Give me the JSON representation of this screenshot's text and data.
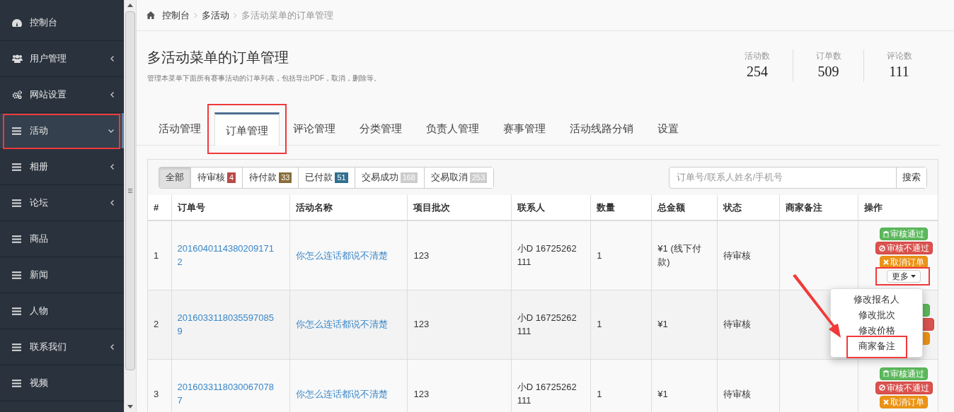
{
  "sidebar": {
    "items": [
      {
        "label": "控制台",
        "kind": "gauge",
        "expandable": false,
        "expanded": false,
        "selected": false,
        "highlighted": false
      },
      {
        "label": "用户管理",
        "kind": "users",
        "expandable": true,
        "expanded": false,
        "selected": false,
        "highlighted": false
      },
      {
        "label": "网站设置",
        "kind": "cogs",
        "expandable": true,
        "expanded": false,
        "selected": false,
        "highlighted": false
      },
      {
        "label": "活动",
        "kind": "bars",
        "expandable": true,
        "expanded": true,
        "selected": true,
        "highlighted": true
      },
      {
        "label": "相册",
        "kind": "bars",
        "expandable": true,
        "expanded": false,
        "selected": false,
        "highlighted": false
      },
      {
        "label": "论坛",
        "kind": "bars",
        "expandable": true,
        "expanded": false,
        "selected": false,
        "highlighted": false
      },
      {
        "label": "商品",
        "kind": "bars",
        "expandable": false,
        "expanded": false,
        "selected": false,
        "highlighted": false
      },
      {
        "label": "新闻",
        "kind": "bars",
        "expandable": false,
        "expanded": false,
        "selected": false,
        "highlighted": false
      },
      {
        "label": "人物",
        "kind": "bars",
        "expandable": false,
        "expanded": false,
        "selected": false,
        "highlighted": false
      },
      {
        "label": "联系我们",
        "kind": "bars",
        "expandable": true,
        "expanded": false,
        "selected": false,
        "highlighted": false
      },
      {
        "label": "视频",
        "kind": "bars",
        "expandable": false,
        "expanded": false,
        "selected": false,
        "highlighted": false
      }
    ]
  },
  "breadcrumb": [
    "控制台",
    "多活动",
    "多活动菜单的订单管理"
  ],
  "header": {
    "title": "多活动菜单的订单管理",
    "description": "管理本菜单下面所有赛事活动的订单列表，包括导出PDF，取消，删除等。",
    "stats": [
      {
        "label": "活动数",
        "value": "254"
      },
      {
        "label": "订单数",
        "value": "509"
      },
      {
        "label": "评论数",
        "value": "111"
      }
    ]
  },
  "tabs": [
    {
      "label": "活动管理",
      "selected": false,
      "highlighted": false
    },
    {
      "label": "订单管理",
      "selected": true,
      "highlighted": true
    },
    {
      "label": "评论管理",
      "selected": false,
      "highlighted": false
    },
    {
      "label": "分类管理",
      "selected": false,
      "highlighted": false
    },
    {
      "label": "负责人管理",
      "selected": false,
      "highlighted": false
    },
    {
      "label": "赛事管理",
      "selected": false,
      "highlighted": false
    },
    {
      "label": "活动线路分销",
      "selected": false,
      "highlighted": false
    },
    {
      "label": "设置",
      "selected": false,
      "highlighted": false
    }
  ],
  "filters": [
    {
      "label": "全部",
      "selected": true
    },
    {
      "label": "待审核",
      "count": "4",
      "color": "#b94a48",
      "selected": false
    },
    {
      "label": "待付款",
      "count": "33",
      "color": "#8a6d3b",
      "selected": false
    },
    {
      "label": "已付款",
      "count": "51",
      "color": "#31708f",
      "selected": false
    },
    {
      "label": "交易成功",
      "count": "168",
      "color": "#cccccc",
      "selected": false
    },
    {
      "label": "交易取消",
      "count": "253",
      "color": "#cccccc",
      "selected": false
    }
  ],
  "search": {
    "placeholder": "订单号/联系人姓名/手机号",
    "button": "搜索"
  },
  "table": {
    "columns": [
      "#",
      "订单号",
      "活动名称",
      "项目批次",
      "联系人",
      "数量",
      "总金额",
      "状态",
      "商家备注",
      "操作"
    ],
    "rows": [
      {
        "index": "1",
        "order_no": "20160401143802091712",
        "activity": "你怎么连话都说不清楚",
        "batch": "123",
        "contact": "小D 16725262111",
        "quantity": "1",
        "amount": "¥1 (线下付款)",
        "status": "待审核",
        "actions": [
          {
            "kind": "approve",
            "label": "审核通过"
          },
          {
            "kind": "reject",
            "label": "审核不通过"
          },
          {
            "kind": "cancel",
            "label": "取消订单"
          },
          {
            "kind": "more",
            "label": "更多",
            "highlighted": true
          }
        ]
      },
      {
        "index": "2",
        "order_no": "20160331180355970859",
        "activity": "你怎么连话都说不清楚",
        "batch": "123",
        "contact": "小D 16725262111",
        "quantity": "1",
        "amount": "¥1",
        "status": "待审核",
        "actions": [
          {
            "kind": "approve"
          },
          {
            "kind": "reject"
          },
          {
            "kind": "cancel"
          }
        ]
      },
      {
        "index": "3",
        "order_no": "20160331180300670787",
        "activity": "你怎么连话都说不清楚",
        "batch": "123",
        "contact": "小D 16725262111",
        "quantity": "1",
        "amount": "¥1",
        "status": "待审核",
        "actions": [
          {
            "kind": "approve",
            "label": "审核通过"
          },
          {
            "kind": "reject",
            "label": "审核不通过"
          },
          {
            "kind": "cancel",
            "label": "取消订单"
          }
        ]
      }
    ]
  },
  "dropdown": {
    "items": [
      {
        "label": "修改报名人",
        "highlighted": false
      },
      {
        "label": "修改批次",
        "highlighted": false
      },
      {
        "label": "修改价格",
        "highlighted": false
      },
      {
        "label": "商家备注",
        "highlighted": true
      }
    ]
  },
  "pointer_arrow": true
}
